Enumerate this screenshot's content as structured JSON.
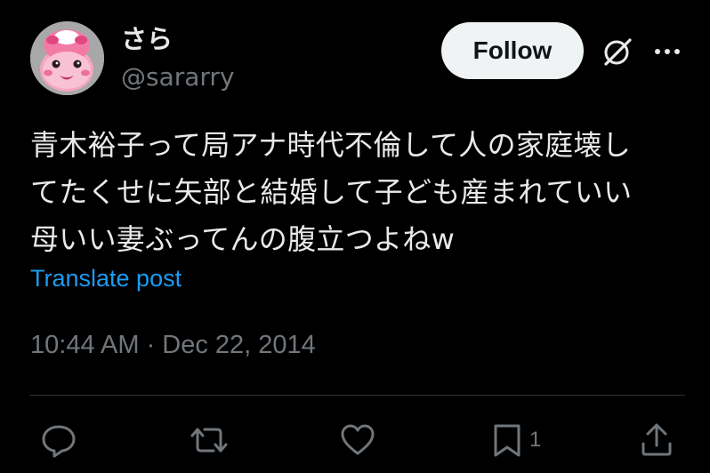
{
  "author": {
    "display_name": "さら",
    "handle": "@sararry",
    "avatar_icon": "pink-character-avatar"
  },
  "header": {
    "follow_label": "Follow",
    "grok_icon": "grok-icon",
    "more_icon": "more-icon"
  },
  "tweet": {
    "lines": [
      "青木裕子って局アナ時代不倫して人の家庭壊し",
      "てたくせに矢部と結婚して子ども産まれていい",
      "母いい妻ぶってんの腹立つよねw"
    ],
    "translate_label": "Translate post",
    "timestamp": "10:44 AM · Dec 22, 2014"
  },
  "actions": {
    "reply_icon": "reply-icon",
    "retweet_icon": "retweet-icon",
    "like_icon": "heart-icon",
    "bookmark_icon": "bookmark-icon",
    "bookmark_count": "1",
    "share_icon": "share-icon"
  },
  "colors": {
    "background": "#000000",
    "text_primary": "#e7e9ea",
    "text_secondary": "#71767b",
    "link": "#1d9bf0",
    "button_bg": "#eff3f4",
    "divider": "#2f3336"
  }
}
